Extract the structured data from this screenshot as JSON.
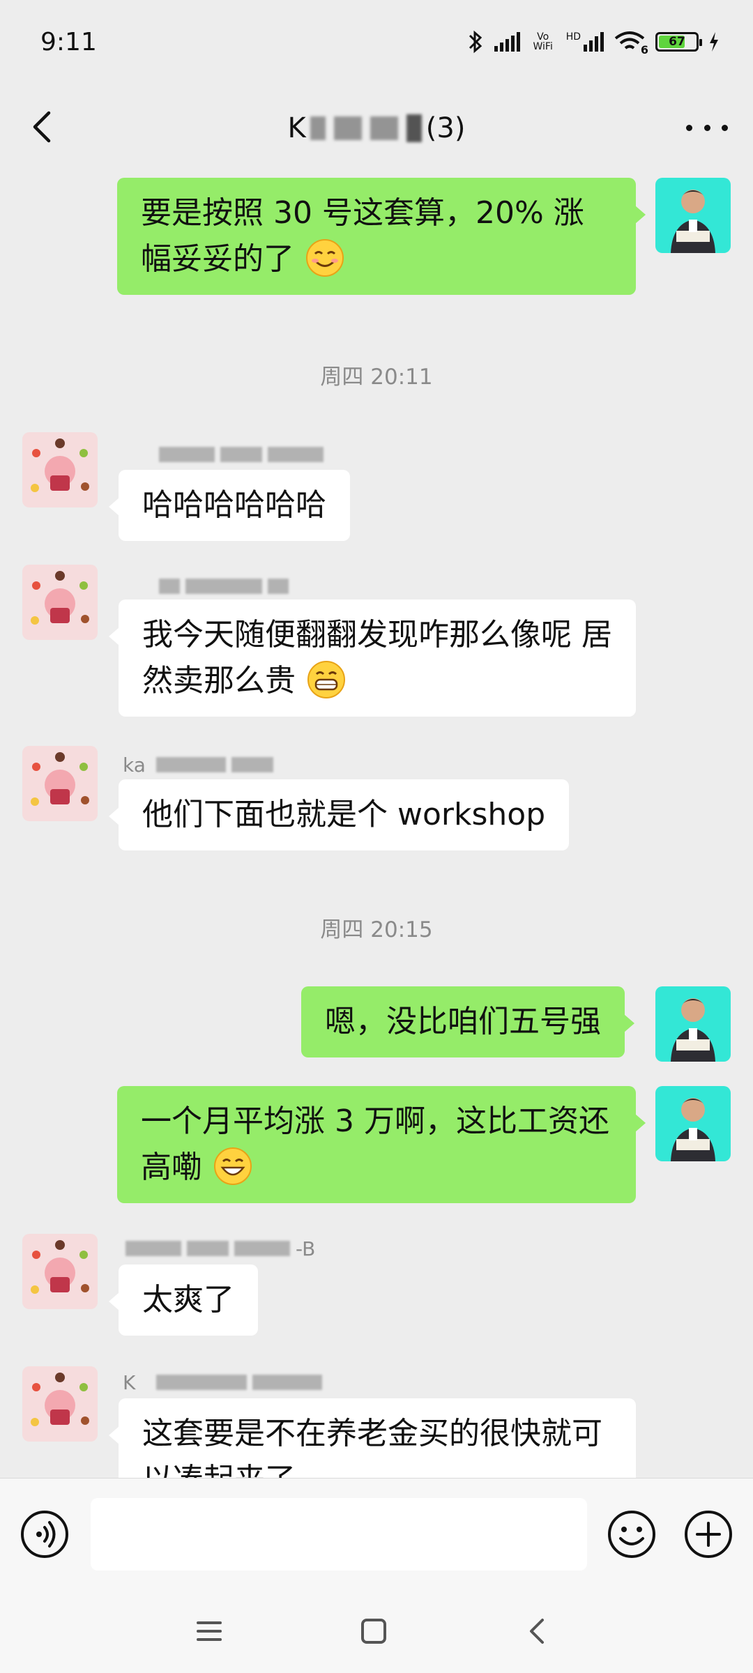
{
  "status_bar": {
    "time": "9:11",
    "volte_label": "Vo WiFi",
    "hd_label": "HD",
    "wifi_label": "6",
    "battery_level": "67"
  },
  "header": {
    "title_suffix": "(3)",
    "title_prefix_visible": "K"
  },
  "messages": {
    "m1": {
      "sender": "me",
      "text": "要是按照 30 号这套算，20% 涨幅妥妥的了"
    },
    "ts1": "周四 20:11",
    "m2": {
      "sender": "other",
      "name_partial": "",
      "text": "哈哈哈哈哈哈"
    },
    "m3": {
      "sender": "other",
      "name_partial": "",
      "text": "我今天随便翻翻发现咋那么像呢 居然卖那么贵"
    },
    "m4": {
      "sender": "other",
      "name_partial": "ka",
      "text": "他们下面也就是个 workshop"
    },
    "ts2": "周四 20:15",
    "m5": {
      "sender": "me",
      "text": "嗯，没比咱们五号强"
    },
    "m6": {
      "sender": "me",
      "text": "一个月平均涨 3 万啊，这比工资还高嘞"
    },
    "m7": {
      "sender": "other",
      "name_partial": "-B",
      "text": "太爽了"
    },
    "m8": {
      "sender": "other",
      "name_partial": "K",
      "text": "这套要是不在养老金买的很快就可以凑起来了"
    }
  },
  "input": {
    "placeholder": ""
  },
  "colors": {
    "background": "#ededed",
    "bubble_me": "#95ec69",
    "bubble_other": "#ffffff",
    "timestamp": "#8a8a8a"
  },
  "icons": {
    "status": [
      "bluetooth-icon",
      "signal-icon",
      "wifi-icon",
      "battery-icon",
      "charging-icon"
    ],
    "nav": [
      "back-icon",
      "more-icon"
    ],
    "input": [
      "voice-icon",
      "emoji-icon",
      "plus-icon"
    ],
    "system": [
      "menu-icon",
      "home-icon",
      "back-nav-icon"
    ]
  }
}
